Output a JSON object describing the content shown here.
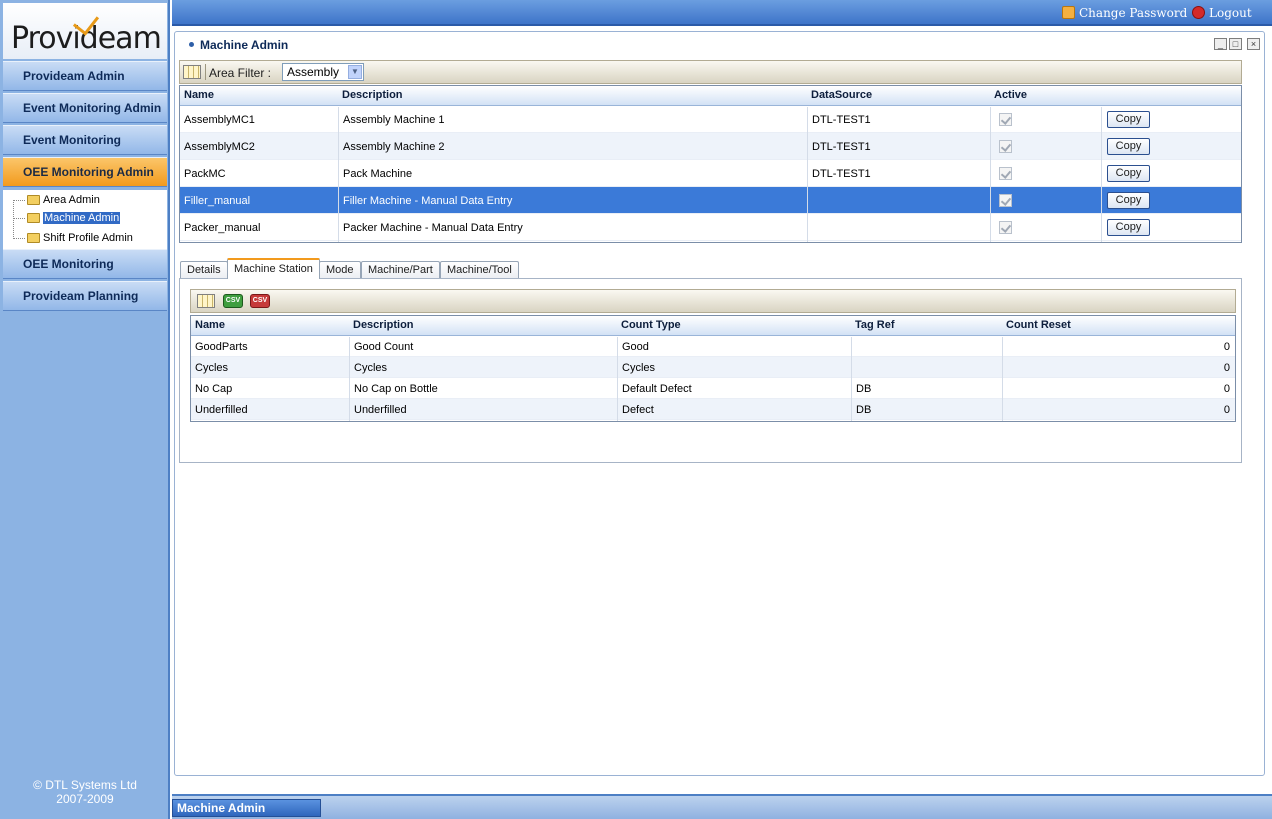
{
  "app": {
    "logo_text": "Provideam",
    "copyright_line1": "© DTL Systems Ltd",
    "copyright_line2": "2007-2009"
  },
  "sidebar": {
    "items": [
      {
        "label": "Provideam Admin"
      },
      {
        "label": "Event Monitoring Admin"
      },
      {
        "label": "Event Monitoring"
      },
      {
        "label": "OEE Monitoring Admin",
        "active": true
      },
      {
        "label": "OEE Monitoring"
      },
      {
        "label": "Provideam Planning"
      }
    ],
    "tree": [
      {
        "label": "Area Admin"
      },
      {
        "label": "Machine Admin",
        "selected": true
      },
      {
        "label": "Shift Profile Admin"
      }
    ]
  },
  "header": {
    "change_password": "Change Password",
    "logout": "Logout"
  },
  "window": {
    "title": "Machine Admin",
    "minimize": "_",
    "maximize": "□",
    "close": "×"
  },
  "filter": {
    "label": "Area Filter :",
    "value": "Assembly",
    "arrow": "▼"
  },
  "machines": {
    "columns": [
      "Name",
      "Description",
      "DataSource",
      "Active"
    ],
    "copy_label": "Copy",
    "rows": [
      {
        "name": "AssemblyMC1",
        "description": "Assembly Machine 1",
        "datasource": "DTL-TEST1",
        "active": true
      },
      {
        "name": "AssemblyMC2",
        "description": "Assembly Machine 2",
        "datasource": "DTL-TEST1",
        "active": true
      },
      {
        "name": "PackMC",
        "description": "Pack Machine",
        "datasource": "DTL-TEST1",
        "active": true
      },
      {
        "name": "Filler_manual",
        "description": "Filler Machine - Manual Data Entry",
        "datasource": "",
        "active": true,
        "selected": true
      },
      {
        "name": "Packer_manual",
        "description": "Packer Machine - Manual Data Entry",
        "datasource": "",
        "active": true
      }
    ]
  },
  "tabs": [
    {
      "label": "Details"
    },
    {
      "label": "Machine Station",
      "active": true
    },
    {
      "label": "Mode"
    },
    {
      "label": "Machine/Part"
    },
    {
      "label": "Machine/Tool"
    }
  ],
  "station_toolbar": {
    "csv_label": "CSV"
  },
  "stations": {
    "columns": [
      "Name",
      "Description",
      "Count Type",
      "Tag Ref",
      "Count Reset"
    ],
    "rows": [
      {
        "name": "GoodParts",
        "description": "Good Count",
        "count_type": "Good",
        "tag_ref": "",
        "count_reset": "0"
      },
      {
        "name": "Cycles",
        "description": "Cycles",
        "count_type": "Cycles",
        "tag_ref": "",
        "count_reset": "0"
      },
      {
        "name": "No Cap",
        "description": "No Cap on Bottle",
        "count_type": "Default Defect",
        "tag_ref": "DB",
        "count_reset": "0"
      },
      {
        "name": "Underfilled",
        "description": "Underfilled",
        "count_type": "Defect",
        "tag_ref": "DB",
        "count_reset": "0"
      }
    ]
  },
  "taskbar": {
    "button": "Machine Admin"
  }
}
